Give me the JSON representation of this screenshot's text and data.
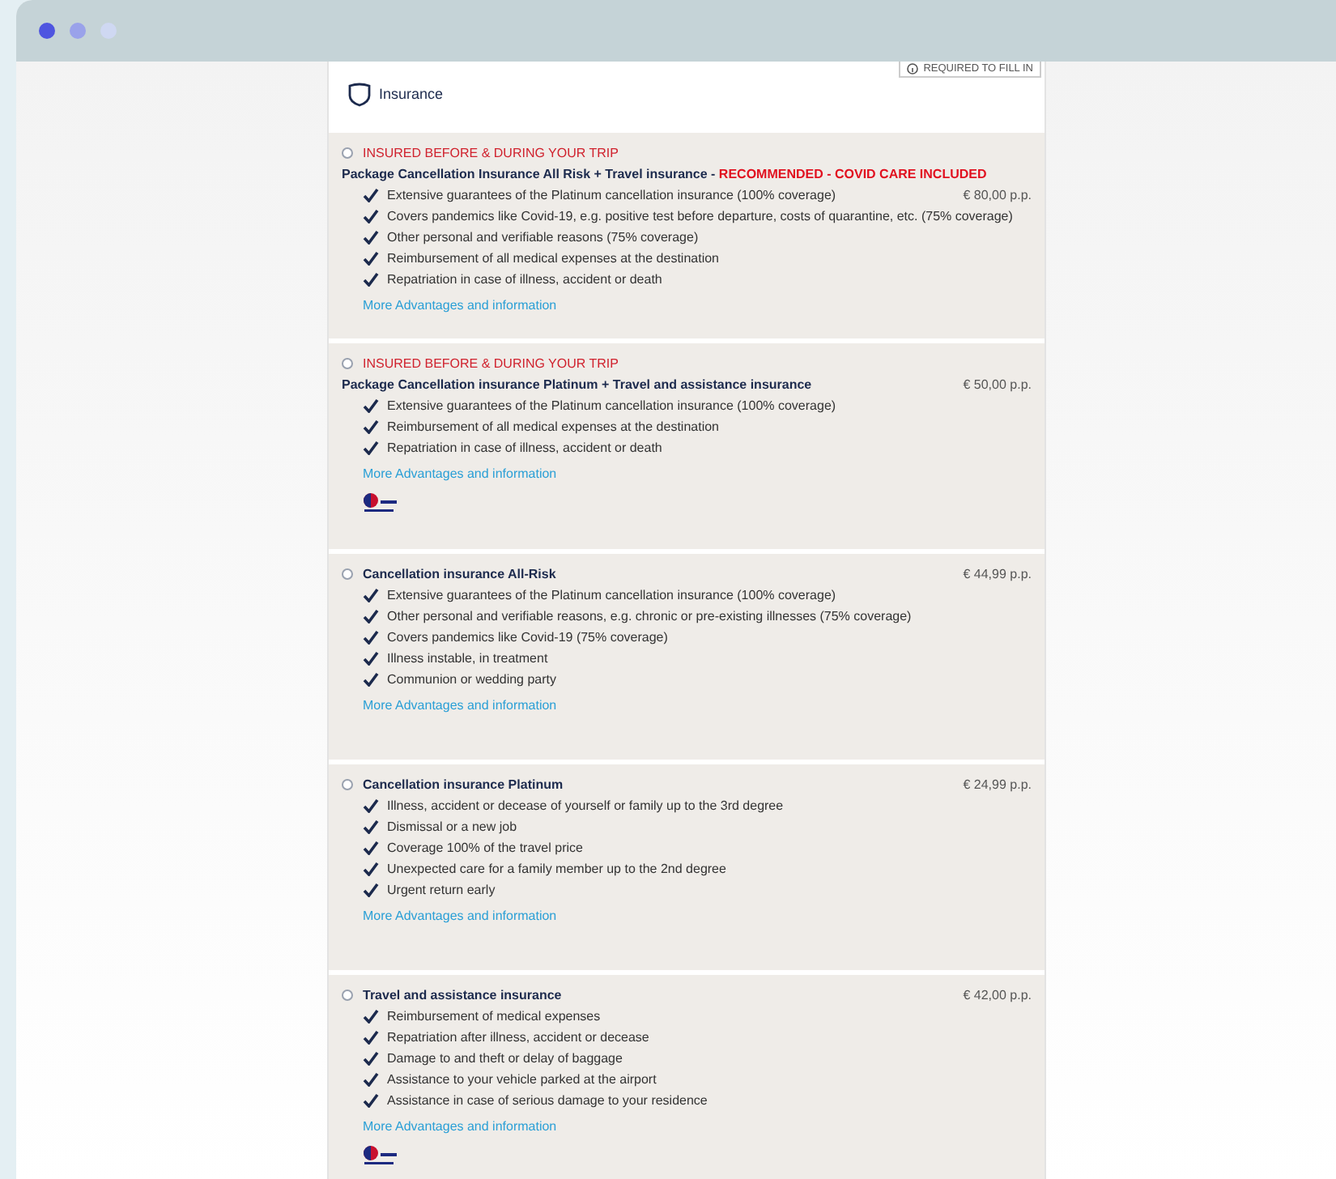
{
  "header": {
    "title": "Insurance",
    "required_badge": "REQUIRED TO FILL IN"
  },
  "options": [
    {
      "selected": false,
      "tag": "INSURED BEFORE & DURING YOUR TRIP",
      "title": "Package Cancellation Insurance All Risk + Travel insurance - ",
      "highlight": "RECOMMENDED - COVID CARE INCLUDED",
      "features": [
        {
          "text": "Extensive guarantees of the Platinum cancellation insurance (100% coverage)",
          "price": "€ 80,00 p.p."
        },
        {
          "text": "Covers pandemics like Covid-19, e.g. positive test before departure, costs of quarantine, etc. (75% coverage)"
        },
        {
          "text": "Other personal and verifiable reasons (75% coverage)"
        },
        {
          "text": "Reimbursement of all medical expenses at the destination"
        },
        {
          "text": "Repatriation in case of illness, accident or death"
        }
      ],
      "link": "More Advantages and information",
      "has_logo": false
    },
    {
      "selected": false,
      "tag": "INSURED BEFORE & DURING YOUR TRIP",
      "title": "Package Cancellation insurance Platinum + Travel and assistance insurance",
      "price": "€ 50,00 p.p.",
      "features": [
        {
          "text": "Extensive guarantees of the Platinum cancellation insurance (100% coverage)"
        },
        {
          "text": "Reimbursement of all medical expenses at the destination"
        },
        {
          "text": "Repatriation in case of illness, accident or death"
        }
      ],
      "link": "More Advantages and information",
      "has_logo": true
    },
    {
      "selected": false,
      "title": "Cancellation insurance All-Risk",
      "price": "€ 44,99 p.p.",
      "features": [
        {
          "text": "Extensive guarantees of the Platinum cancellation insurance (100% coverage)"
        },
        {
          "text": "Other personal and verifiable reasons, e.g. chronic or pre-existing illnesses (75% coverage)"
        },
        {
          "text": "Covers pandemics like Covid-19 (75% coverage)"
        },
        {
          "text": "Illness instable, in treatment"
        },
        {
          "text": "Communion or wedding party"
        }
      ],
      "link": "More Advantages and information",
      "has_logo": false
    },
    {
      "selected": false,
      "title": "Cancellation insurance Platinum",
      "price": "€ 24,99 p.p.",
      "features": [
        {
          "text": "Illness, accident or decease of yourself or family up to the 3rd degree"
        },
        {
          "text": "Dismissal or a new job"
        },
        {
          "text": "Coverage 100% of the travel price"
        },
        {
          "text": "Unexpected care for a family member up to the 2nd degree"
        },
        {
          "text": "Urgent return early"
        }
      ],
      "link": "More Advantages and information",
      "has_logo": false
    },
    {
      "selected": false,
      "title": "Travel and assistance insurance",
      "price": "€ 42,00 p.p.",
      "features": [
        {
          "text": "Reimbursement of medical expenses"
        },
        {
          "text": "Repatriation after illness, accident or decease"
        },
        {
          "text": "Damage to and theft or delay of baggage"
        },
        {
          "text": "Assistance to your vehicle parked at the airport"
        },
        {
          "text": "Assistance in case of serious damage to your residence"
        }
      ],
      "link": "More Advantages and information",
      "has_logo": true
    }
  ]
}
